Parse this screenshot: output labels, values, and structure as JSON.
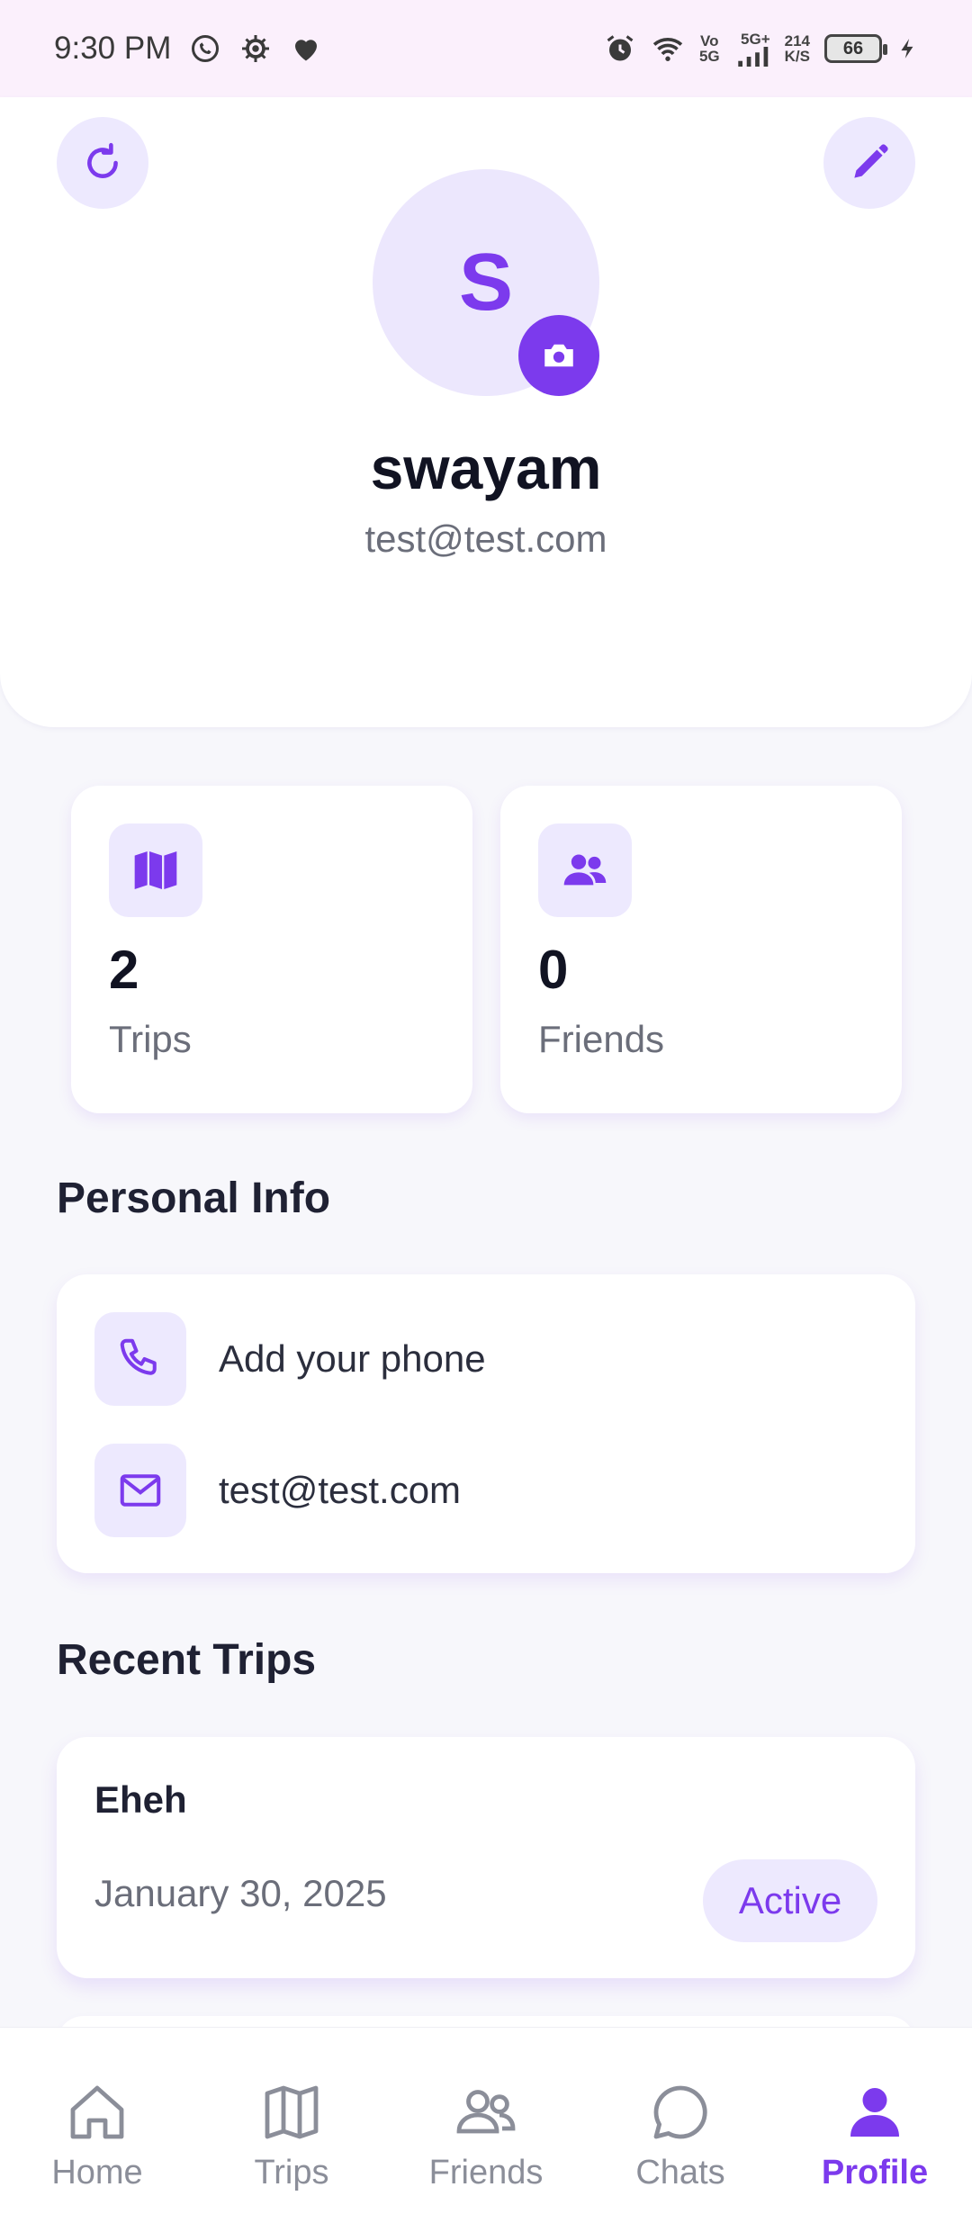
{
  "status_bar": {
    "time": "9:30 PM",
    "network_top": "Vo",
    "network_bottom": "5G",
    "signal_label": "5G+",
    "speed_value": "214",
    "speed_unit": "K/S",
    "battery": "66"
  },
  "profile": {
    "avatar_initial": "S",
    "name": "swayam",
    "email": "test@test.com"
  },
  "stats": [
    {
      "value": "2",
      "label": "Trips",
      "icon": "map-icon"
    },
    {
      "value": "0",
      "label": "Friends",
      "icon": "users-icon"
    }
  ],
  "personal_info": {
    "title": "Personal Info",
    "phone": "Add your phone",
    "email": "test@test.com"
  },
  "recent_trips": {
    "title": "Recent Trips",
    "items": [
      {
        "name": "Eheh",
        "date": "January 30, 2025",
        "status": "Active"
      }
    ]
  },
  "nav": {
    "items": [
      {
        "label": "Home",
        "icon": "home-icon"
      },
      {
        "label": "Trips",
        "icon": "map-icon"
      },
      {
        "label": "Friends",
        "icon": "users-icon"
      },
      {
        "label": "Chats",
        "icon": "chat-icon"
      },
      {
        "label": "Profile",
        "icon": "user-icon"
      }
    ],
    "active": "Profile"
  },
  "colors": {
    "accent": "#7c3aed",
    "accent_light": "#ede9fe",
    "background": "#f7f7fb",
    "status_bar": "#fbf0fc"
  }
}
